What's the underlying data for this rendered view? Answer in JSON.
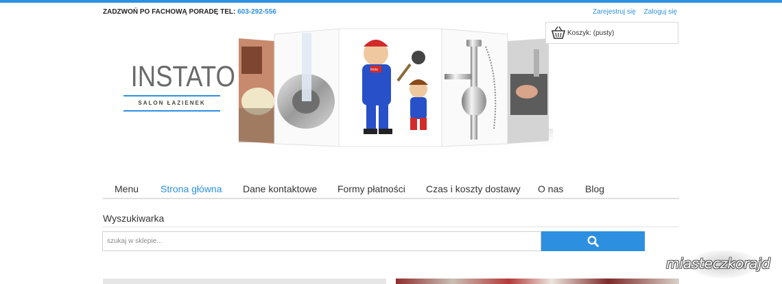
{
  "header": {
    "phone_label": "ZADZWOŃ PO FACHOWĄ PORADĘ TEL:",
    "phone_number": "603-292-556",
    "register_label": "Zarejestruj się",
    "login_label": "Zaloguj się"
  },
  "logo": {
    "title": "INSTATO",
    "subtitle": "SALON ŁAZIENEK"
  },
  "hero": {
    "badge_text": "Insta"
  },
  "cart": {
    "label": "Koszyk: (pusty)"
  },
  "nav": {
    "items": [
      {
        "label": "Menu",
        "active": false
      },
      {
        "label": "Strona główna",
        "active": true
      },
      {
        "label": "Dane kontaktowe",
        "active": false
      },
      {
        "label": "Formy płatności",
        "active": false
      },
      {
        "label": "Czas i koszty dostawy",
        "active": false
      },
      {
        "label": "O nas",
        "active": false
      },
      {
        "label": "Blog",
        "active": false
      }
    ]
  },
  "search": {
    "title": "Wyszukiwarka",
    "placeholder": "szukaj w sklepie..."
  },
  "watermark": {
    "text": "miasteczkorajd"
  },
  "colors": {
    "accent": "#2d8fe0"
  }
}
